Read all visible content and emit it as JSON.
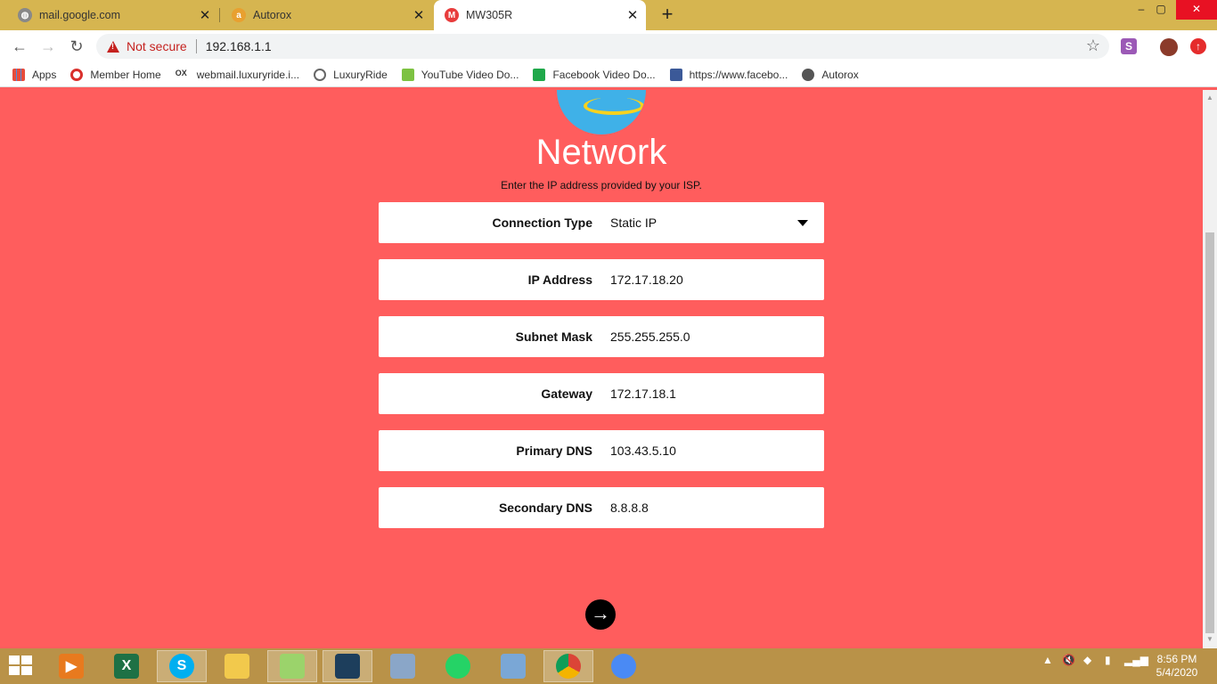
{
  "browser": {
    "tabs": [
      {
        "title": "mail.google.com",
        "favicon": "globe-icon",
        "active": false
      },
      {
        "title": "Autorox",
        "favicon": "autorox-icon",
        "active": false
      },
      {
        "title": "MW305R",
        "favicon": "mercusys-icon",
        "active": true
      }
    ],
    "new_tab_label": "+",
    "window_controls": {
      "minimize": "–",
      "maximize": "▢",
      "close": "✕"
    },
    "security_label": "Not secure",
    "url": "192.168.1.1",
    "bookmarks": [
      {
        "label": "Apps",
        "icon": "apps-grid-icon"
      },
      {
        "label": "Member Home",
        "icon": "member-home-icon"
      },
      {
        "label": "webmail.luxuryride.i...",
        "icon": "ox-icon"
      },
      {
        "label": "LuxuryRide",
        "icon": "luxuryride-icon"
      },
      {
        "label": "YouTube Video Do...",
        "icon": "download-arrow-icon"
      },
      {
        "label": "Facebook Video Do...",
        "icon": "green-download-icon"
      },
      {
        "label": "https://www.facebo...",
        "icon": "facebook-icon"
      },
      {
        "label": "Autorox",
        "icon": "globe-icon"
      }
    ]
  },
  "page": {
    "title": "Network",
    "subtitle": "Enter the IP address provided by your ISP.",
    "fields": [
      {
        "label": "Connection Type",
        "value": "Static IP",
        "type": "select"
      },
      {
        "label": "IP Address",
        "value": "172.17.18.20",
        "type": "input"
      },
      {
        "label": "Subnet Mask",
        "value": "255.255.255.0",
        "type": "input"
      },
      {
        "label": "Gateway",
        "value": "172.17.18.1",
        "type": "input"
      },
      {
        "label": "Primary DNS",
        "value": "103.43.5.10",
        "type": "input"
      },
      {
        "label": "Secondary DNS",
        "value": "8.8.8.8",
        "type": "input"
      }
    ],
    "next_icon": "→",
    "colors": {
      "background": "#ff5d5d",
      "field_bg": "#ffffff",
      "next_button": "#000000"
    }
  },
  "taskbar": {
    "apps": [
      {
        "name": "media-player-icon"
      },
      {
        "name": "excel-icon",
        "glyph": "X"
      },
      {
        "name": "skype-icon",
        "glyph": "S"
      },
      {
        "name": "file-explorer-icon"
      },
      {
        "name": "notepad-plus-icon"
      },
      {
        "name": "mysql-workbench-icon"
      },
      {
        "name": "calculator-icon"
      },
      {
        "name": "whatsapp-icon"
      },
      {
        "name": "paint-icon"
      },
      {
        "name": "chrome-icon"
      },
      {
        "name": "chrome-canary-icon"
      }
    ],
    "time": "8:56 PM",
    "date": "5/4/2020"
  }
}
